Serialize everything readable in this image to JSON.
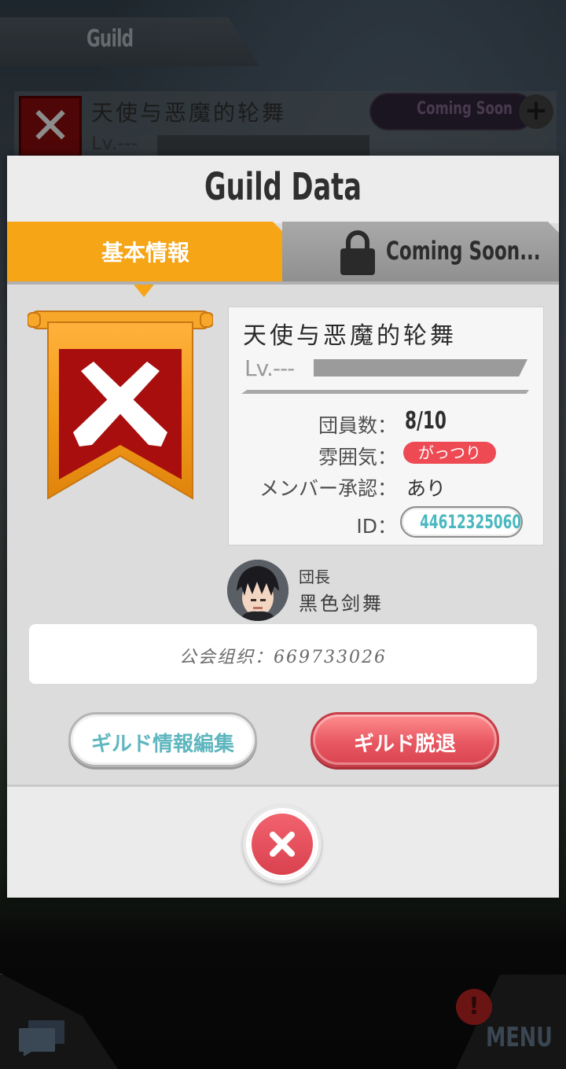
{
  "background": {
    "header_title": "Guild",
    "guild_name": "天使与恶魔的轮舞",
    "guild_level": "Lv.---",
    "coming_soon_label": "Coming Soon",
    "plus_label": "+",
    "menu_label": "MENU",
    "alert_label": "!"
  },
  "dialog": {
    "title": "Guild Data",
    "tabs": [
      {
        "label": "基本情報",
        "active": true
      },
      {
        "label": "Coming Soon...",
        "icon": "lock-icon",
        "active": false
      }
    ],
    "guild": {
      "name": "天使与恶魔的轮舞",
      "level": "Lv.---",
      "emblem_icon": "crossed-swords-icon"
    },
    "info": {
      "members_label": "団員数：",
      "members_value": "8/10",
      "mood_label": "雰囲気：",
      "mood_value": "がっつり",
      "approval_label": "メンバー承認：",
      "approval_value": "あり",
      "id_label": "ID：",
      "id_value": "44612325060"
    },
    "leader": {
      "role": "団長",
      "name": "黑色剑舞",
      "avatar_icon": "avatar"
    },
    "message": "公会组织：669733026",
    "buttons": {
      "edit_label": "ギルド情報編集",
      "leave_label": "ギルド脱退"
    },
    "close_icon": "close-icon"
  },
  "colors": {
    "tab_active": "#f5a515",
    "emblem_red": "#a80e0e",
    "mood_badge": "#ee4a54",
    "id_text": "#4bb8c0",
    "leave_button": "#e85862",
    "edit_text": "#5eb6bf"
  }
}
